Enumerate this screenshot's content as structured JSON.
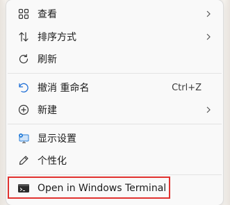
{
  "menu": {
    "items": [
      {
        "id": "view",
        "label": "查看",
        "icon": "grid-icon",
        "submenu": true
      },
      {
        "id": "sort",
        "label": "排序方式",
        "icon": "sort-arrows-icon",
        "submenu": true
      },
      {
        "id": "refresh",
        "label": "刷新",
        "icon": "refresh-icon",
        "submenu": false
      },
      {
        "id": "undo",
        "label": "撤消 重命名",
        "icon": "undo-icon",
        "shortcut": "Ctrl+Z",
        "submenu": false
      },
      {
        "id": "new",
        "label": "新建",
        "icon": "plus-circle-icon",
        "submenu": true
      },
      {
        "id": "display",
        "label": "显示设置",
        "icon": "display-settings-icon",
        "submenu": false
      },
      {
        "id": "personalize",
        "label": "个性化",
        "icon": "pen-icon",
        "submenu": false
      },
      {
        "id": "terminal",
        "label": "Open in Windows Terminal",
        "icon": "terminal-icon",
        "submenu": false
      }
    ]
  },
  "colors": {
    "menu_bg": "#f9f9f9",
    "highlight_border": "#e0312e",
    "accent": "#1f6fd6"
  }
}
